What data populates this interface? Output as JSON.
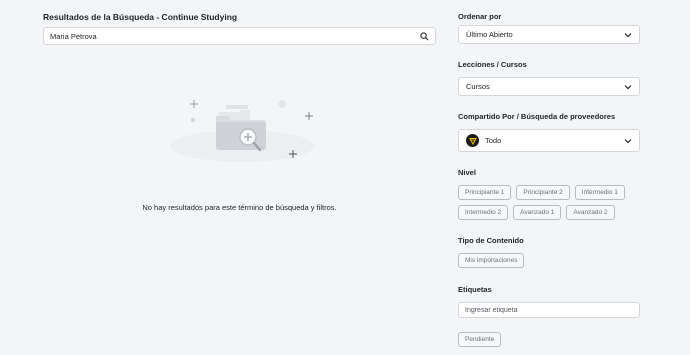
{
  "search": {
    "title": "Resultados de la Búsqueda - Continue Studying",
    "value": "Maria Petrova",
    "icon": "search-icon"
  },
  "empty_state": {
    "message": "No hay resultados para este término de búsqueda y filtros.",
    "icon": "empty-folder-search-illustration"
  },
  "filters": {
    "sort": {
      "label": "Ordenar por",
      "value": "Último Abierto"
    },
    "lessons": {
      "label": "Lecciones / Cursos",
      "value": "Cursos"
    },
    "shared": {
      "label": "Compartido Por / Búsqueda de proveedores",
      "value": "Todo"
    },
    "level": {
      "label": "Nivel",
      "options": [
        "Principiante 1",
        "Principiante 2",
        "Intermedio 1",
        "Intermedio 2",
        "Avanzado 1",
        "Avanzado 2"
      ]
    },
    "content_type": {
      "label": "Tipo de Contenido",
      "options": [
        "Mis importaciones"
      ]
    },
    "tags": {
      "label": "Etiquetas",
      "placeholder": "Ingresar etiqueta",
      "options": [
        "Pendiente"
      ]
    }
  },
  "colors": {
    "background": "#f4f5f7",
    "border": "#d4d7dc",
    "brand_badge": "#1c1c1c",
    "brand_accent": "#f5c400"
  }
}
